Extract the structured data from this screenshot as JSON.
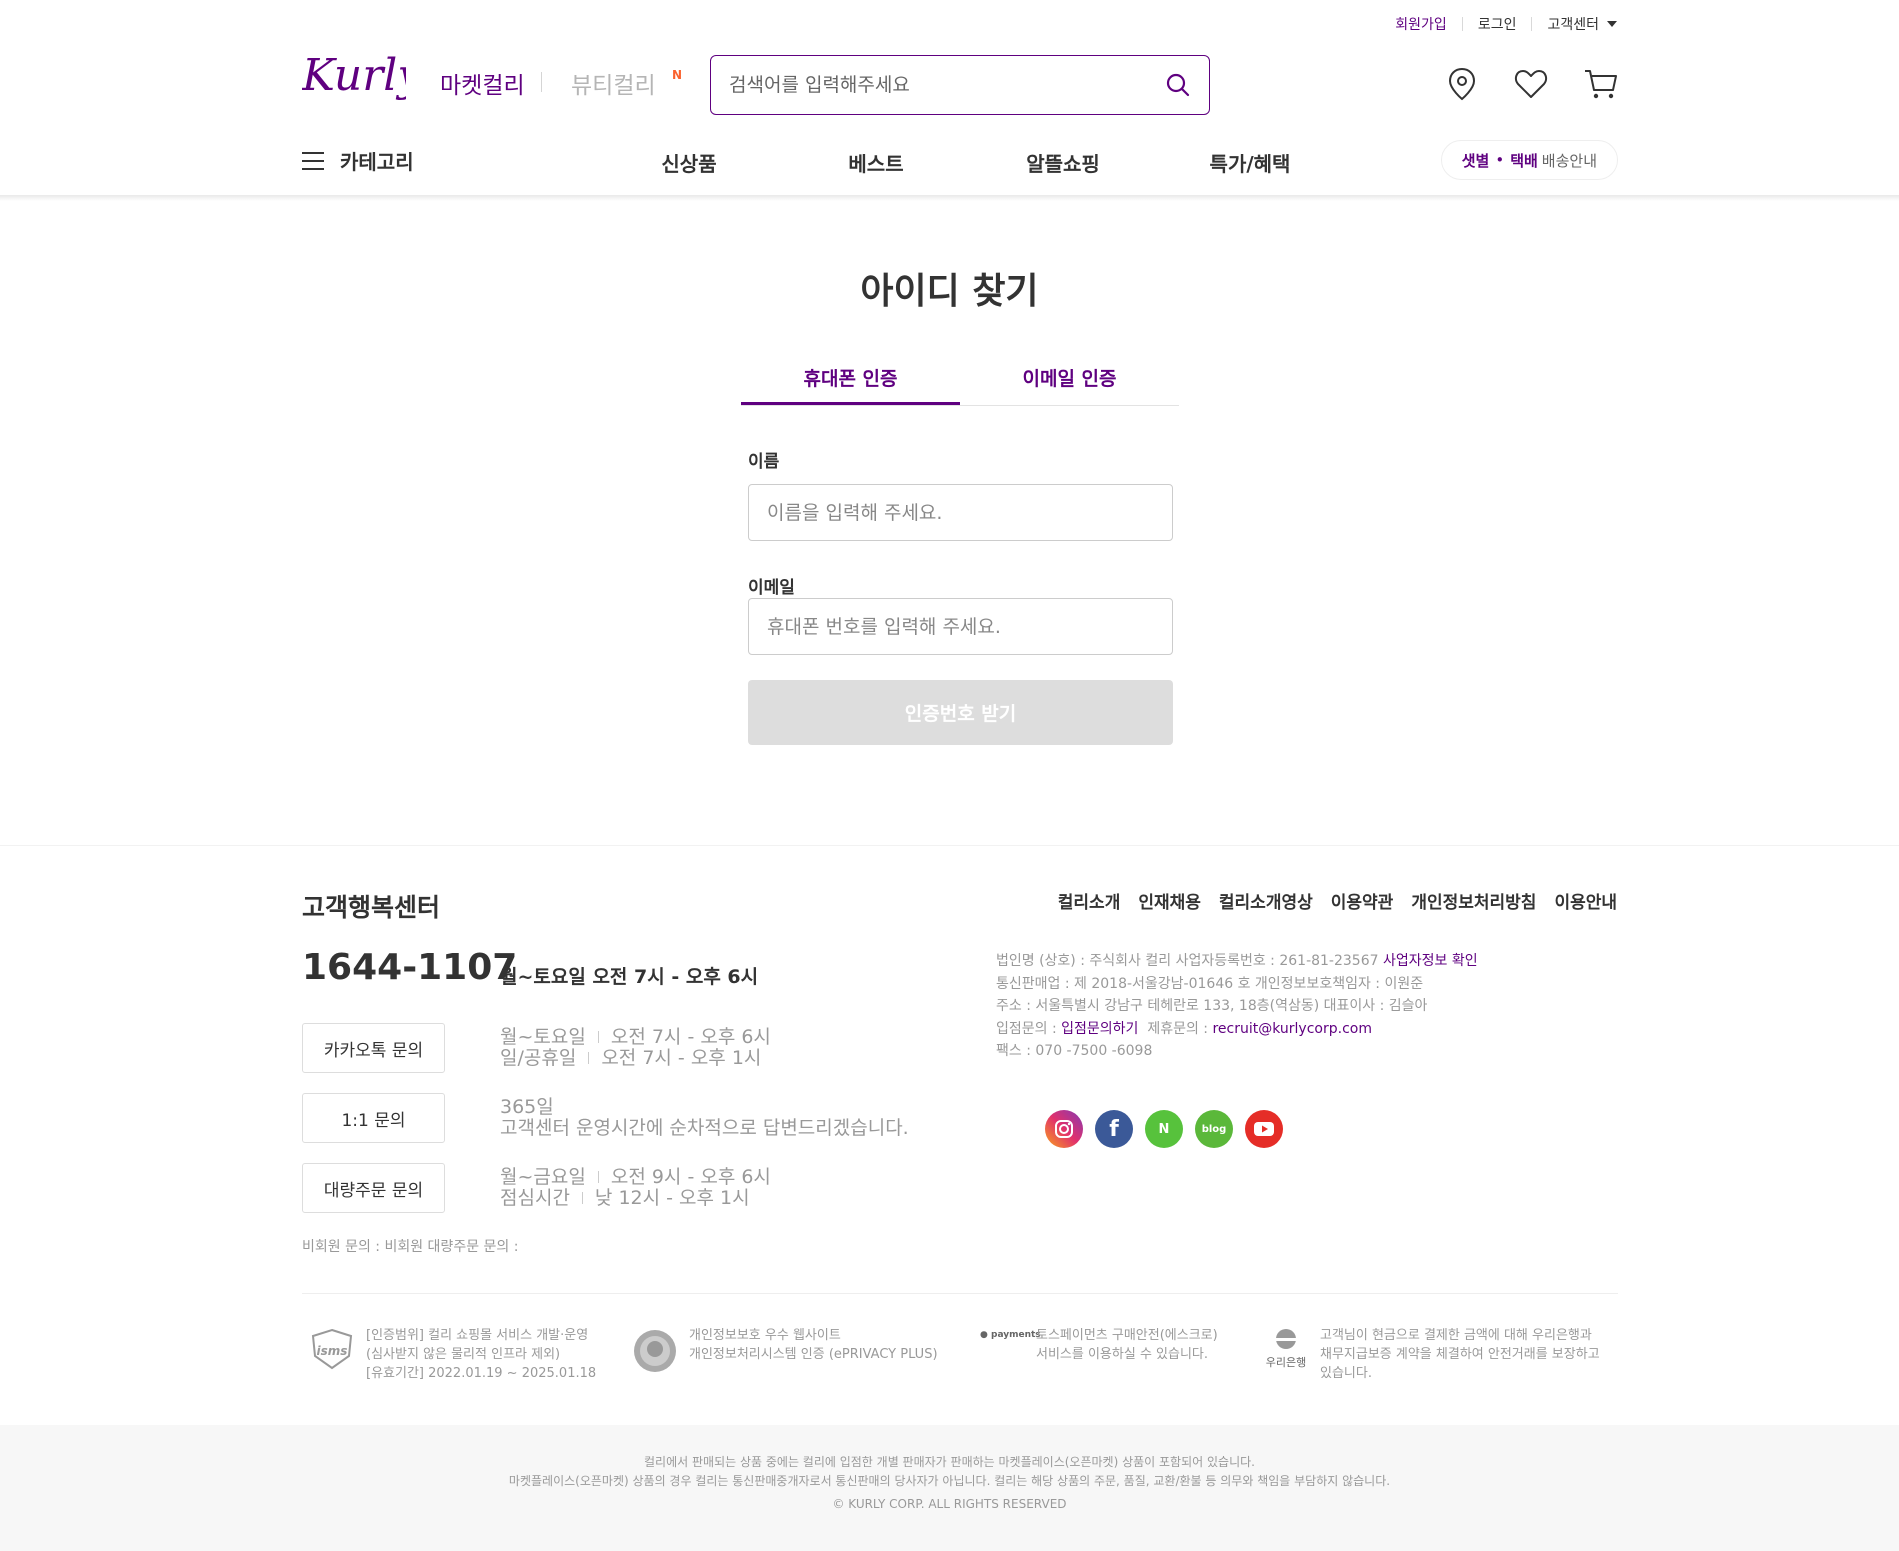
{
  "top_links": {
    "join": "회원가입",
    "login": "로그인",
    "customer_center": "고객센터"
  },
  "header": {
    "logo_text": "Kurly",
    "market_kurly": "마켓컬리",
    "beauty_kurly": "뷰티컬리",
    "beauty_badge": "N",
    "search_placeholder": "검색어를 입력해주세요"
  },
  "nav": {
    "category": "카테고리",
    "items": [
      "신상품",
      "베스트",
      "알뜰쇼핑",
      "특가/혜택"
    ],
    "delivery_dawn": "샛별",
    "delivery_parcel": "택배",
    "delivery_info": "배송안내"
  },
  "page": {
    "title": "아이디 찾기",
    "tabs": [
      "휴대폰 인증",
      "이메일 인증"
    ],
    "active_tab": "휴대폰 인증",
    "name_label": "이름",
    "name_placeholder": "이름을 입력해 주세요.",
    "email_label": "이메일",
    "phone_placeholder": "휴대폰 번호를 입력해 주세요.",
    "submit_label": "인증번호 받기"
  },
  "footer": {
    "cs_title": "고객행복센터",
    "phone": "1644-1107",
    "phone_hours": "월~토요일 오전 7시 - 오후 6시",
    "kakao_button": "카카오톡 문의",
    "kakao_line1_a": "월~토요일",
    "kakao_line1_b": "오전 7시 - 오후 6시",
    "kakao_line2_a": "일/공휴일",
    "kakao_line2_b": "오전 7시 - 오후 1시",
    "qna_button": "1:1 문의",
    "qna_line1": "365일",
    "qna_line2": "고객센터 운영시간에 순차적으로 답변드리겠습니다.",
    "bulk_button": "대량주문 문의",
    "bulk_line1_a": "월~금요일",
    "bulk_line1_b": "오전 9시 - 오후 6시",
    "bulk_line2_a": "점심시간",
    "bulk_line2_b": "낮 12시 - 오후 1시",
    "nonmember": "비회원 문의 : 비회원 대량주문 문의 :",
    "links": [
      "컬리소개",
      "인재채용",
      "컬리소개영상",
      "이용약관",
      "개인정보처리방침",
      "이용안내"
    ],
    "corp_line1": "법인명 (상호) : 주식회사 컬리  사업자등록번호 : 261-81-23567",
    "corp_line1_link": "사업자정보 확인",
    "corp_line2": "통신판매업 : 제 2018-서울강남-01646 호  개인정보보호책임자 : 이원준",
    "corp_line3": "주소 : 서울특별시 강남구 테헤란로 133, 18층(역삼동)  대표이사 : 김슬아",
    "corp_line4_a": "입점문의 :",
    "corp_line4_link": "입점문의하기",
    "corp_line4_b": "제휴문의 :",
    "corp_line4_email": "recruit@kurlycorp.com",
    "corp_line5": "팩스 : 070 -7500 -6098",
    "social": [
      "instagram",
      "facebook",
      "naver-blog",
      "blog",
      "youtube"
    ],
    "cert1_l1": "[인증범위] 컬리 쇼핑몰 서비스 개발·운영",
    "cert1_l2": "(심사받지 않은 물리적 인프라 제외)",
    "cert1_l3": "[유효기간] 2022.01.19 ~ 2025.01.18",
    "cert2_l1": "개인정보보호 우수 웹사이트",
    "cert2_l2": "개인정보처리시스템 인증 (ePRIVACY PLUS)",
    "cert3_logo": "payments",
    "cert3_l1": "토스페이먼츠 구매안전(에스크로)",
    "cert3_l2": "서비스를 이용하실 수 있습니다.",
    "cert4_logo": "우리은행",
    "cert4_l1": "고객님이 현금으로 결제한 금액에 대해 우리은행과",
    "cert4_l2": "채무지급보증 계약을 체결하여 안전거래를 보장하고",
    "cert4_l3": "있습니다.",
    "cert1_logo": "isms",
    "bottom_line1": "컬리에서 판매되는 상품 중에는 컬리에 입점한 개별 판매자가 판매하는 마켓플레이스(오픈마켓) 상품이 포함되어 있습니다.",
    "bottom_line2": "마켓플레이스(오픈마켓) 상품의 경우 컬리는 통신판매중개자로서 통신판매의 당사자가 아닙니다. 컬리는 해당 상품의 주문, 품질, 교환/환불 등 의무와 책임을 부담하지 않습니다.",
    "copyright": "© KURLY CORP. ALL RIGHTS RESERVED"
  },
  "colors": {
    "brand": "#5f0080",
    "disabled": "#dddddd",
    "new_badge": "#fa622f"
  }
}
